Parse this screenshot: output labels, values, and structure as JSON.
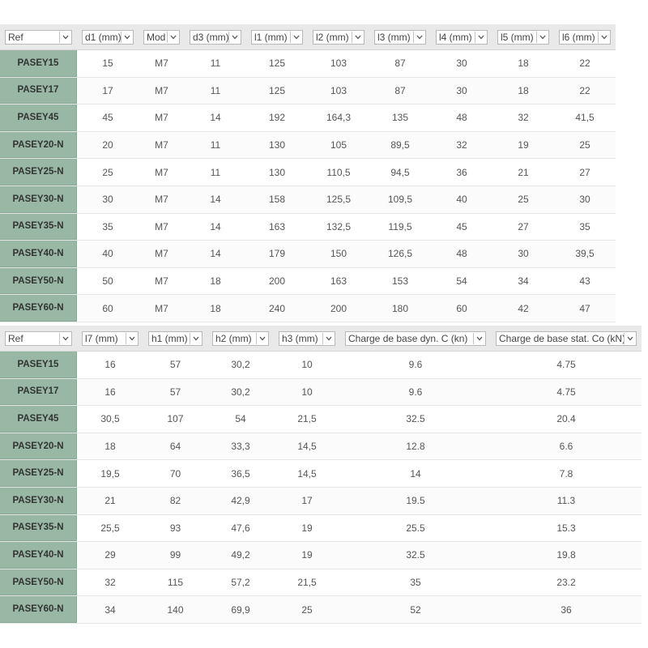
{
  "colors": {
    "ref_bg": "#98b7a4",
    "header_bg": "#e9e9e9"
  },
  "table1": {
    "filters": [
      "Ref",
      "d1 (mm)",
      "Mod",
      "d3 (mm)",
      "l1 (mm)",
      "l2 (mm)",
      "l3 (mm)",
      "l4 (mm)",
      "l5 (mm)",
      "l6 (mm)"
    ],
    "rows": [
      [
        "PASEY15",
        "15",
        "M7",
        "11",
        "125",
        "103",
        "87",
        "30",
        "18",
        "22"
      ],
      [
        "PASEY17",
        "17",
        "M7",
        "11",
        "125",
        "103",
        "87",
        "30",
        "18",
        "22"
      ],
      [
        "PASEY45",
        "45",
        "M7",
        "14",
        "192",
        "164,3",
        "135",
        "48",
        "32",
        "41,5"
      ],
      [
        "PASEY20-N",
        "20",
        "M7",
        "11",
        "130",
        "105",
        "89,5",
        "32",
        "19",
        "25"
      ],
      [
        "PASEY25-N",
        "25",
        "M7",
        "11",
        "130",
        "110,5",
        "94,5",
        "36",
        "21",
        "27"
      ],
      [
        "PASEY30-N",
        "30",
        "M7",
        "14",
        "158",
        "125,5",
        "109,5",
        "40",
        "25",
        "30"
      ],
      [
        "PASEY35-N",
        "35",
        "M7",
        "14",
        "163",
        "132,5",
        "119,5",
        "45",
        "27",
        "35"
      ],
      [
        "PASEY40-N",
        "40",
        "M7",
        "14",
        "179",
        "150",
        "126,5",
        "48",
        "30",
        "39,5"
      ],
      [
        "PASEY50-N",
        "50",
        "M7",
        "18",
        "200",
        "163",
        "153",
        "54",
        "34",
        "43"
      ],
      [
        "PASEY60-N",
        "60",
        "M7",
        "18",
        "240",
        "200",
        "180",
        "60",
        "42",
        "47"
      ]
    ]
  },
  "table2": {
    "filters": [
      "Ref",
      "l7 (mm)",
      "h1 (mm)",
      "h2 (mm)",
      "h3 (mm)",
      "Charge de base dyn. C (kn)",
      "Charge de base stat. Co (kN)"
    ],
    "rows": [
      [
        "PASEY15",
        "16",
        "57",
        "30,2",
        "10",
        "9.6",
        "4.75"
      ],
      [
        "PASEY17",
        "16",
        "57",
        "30,2",
        "10",
        "9.6",
        "4.75"
      ],
      [
        "PASEY45",
        "30,5",
        "107",
        "54",
        "21,5",
        "32.5",
        "20.4"
      ],
      [
        "PASEY20-N",
        "18",
        "64",
        "33,3",
        "14,5",
        "12.8",
        "6.6"
      ],
      [
        "PASEY25-N",
        "19,5",
        "70",
        "36,5",
        "14,5",
        "14",
        "7.8"
      ],
      [
        "PASEY30-N",
        "21",
        "82",
        "42,9",
        "17",
        "19.5",
        "11.3"
      ],
      [
        "PASEY35-N",
        "25,5",
        "93",
        "47,6",
        "19",
        "25.5",
        "15.3"
      ],
      [
        "PASEY40-N",
        "29",
        "99",
        "49,2",
        "19",
        "32.5",
        "19.8"
      ],
      [
        "PASEY50-N",
        "32",
        "115",
        "57,2",
        "21,5",
        "35",
        "23.2"
      ],
      [
        "PASEY60-N",
        "34",
        "140",
        "69,9",
        "25",
        "52",
        "36"
      ]
    ]
  },
  "icons": {
    "dropdown": "chevron-down-icon"
  }
}
